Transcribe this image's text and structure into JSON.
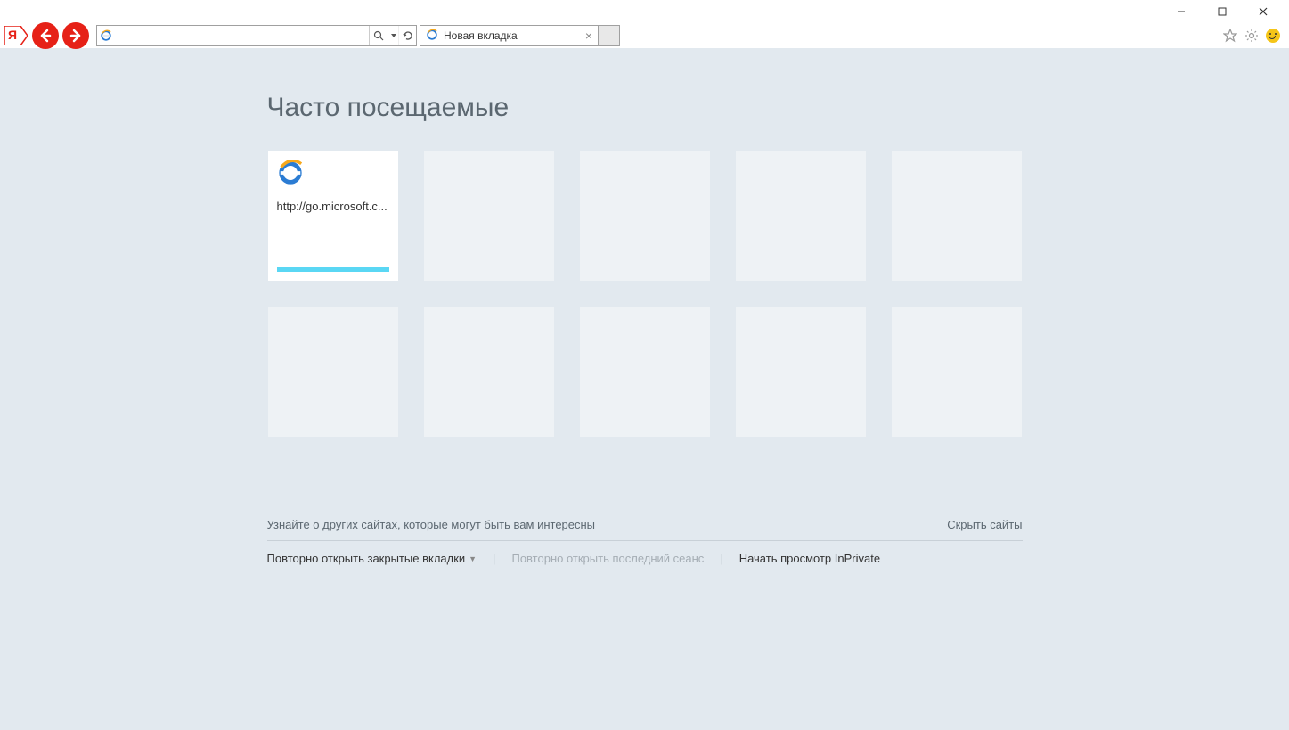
{
  "window": {
    "tab_title": "Новая вкладка"
  },
  "address_bar": {
    "value": "",
    "search_tooltip": "Поиск",
    "refresh_tooltip": "Обновить"
  },
  "page": {
    "title": "Часто посещаемые",
    "tiles": [
      {
        "label": "http://go.microsoft.c...",
        "filled": true
      },
      {
        "filled": false
      },
      {
        "filled": false
      },
      {
        "filled": false
      },
      {
        "filled": false
      },
      {
        "filled": false
      },
      {
        "filled": false
      },
      {
        "filled": false
      },
      {
        "filled": false
      },
      {
        "filled": false
      }
    ],
    "discover_text": "Узнайте о других сайтах, которые могут быть вам интересны",
    "hide_sites": "Скрыть сайты",
    "reopen_closed": "Повторно открыть закрытые вкладки",
    "reopen_last_session": "Повторно открыть последний сеанс",
    "inprivate": "Начать просмотр InPrivate"
  }
}
